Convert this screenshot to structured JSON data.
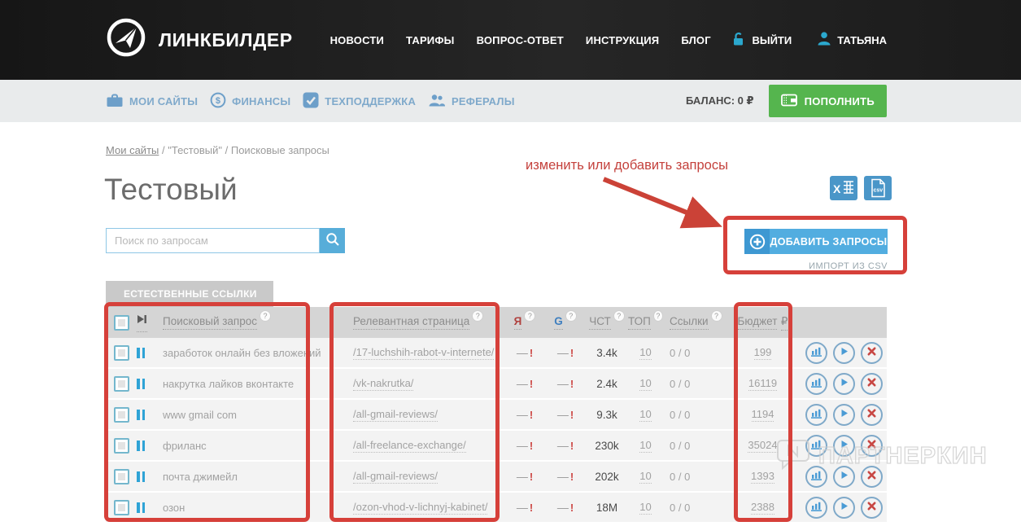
{
  "header": {
    "brand": "ЛИНКБИЛДЕР",
    "nav": [
      "НОВОСТИ",
      "ТАРИФЫ",
      "ВОПРОС-ОТВЕТ",
      "ИНСТРУКЦИЯ",
      "БЛОГ"
    ],
    "logout": "ВЫЙТИ",
    "username": "ТАТЬЯНА"
  },
  "subnav": {
    "items": [
      {
        "label": "МОИ САЙТЫ",
        "icon": "briefcase-icon"
      },
      {
        "label": "ФИНАНСЫ",
        "icon": "dollar-circle-icon"
      },
      {
        "label": "ТЕХПОДДЕРЖКА",
        "icon": "check-square-icon"
      },
      {
        "label": "РЕФЕРАЛЫ",
        "icon": "people-icon"
      }
    ],
    "balance": "БАЛАНС: 0 ₽",
    "topup": "ПОПОЛНИТЬ"
  },
  "breadcrumb": {
    "home": "Мои сайты",
    "sep": "/",
    "site": "\"Тестовый\"",
    "page": "Поисковые запросы"
  },
  "page": {
    "title": "Тестовый"
  },
  "annotation": {
    "text": "изменить или добавить запросы"
  },
  "search": {
    "placeholder": "Поиск по запросам"
  },
  "add": {
    "button": "ДОБАВИТЬ ЗАПРОСЫ",
    "import": "ИМПОРТ ИЗ CSV"
  },
  "export": {
    "excel_icon": "excel-export-icon",
    "csv_icon": "csv-export-icon"
  },
  "tab": {
    "label": "ЕСТЕСТВЕННЫЕ ССЫЛКИ"
  },
  "table": {
    "columns": {
      "query": "Поисковый запрос",
      "page": "Релевантная страница",
      "yandex": "Я",
      "google": "G",
      "chst": "ЧСТ",
      "top": "ТОП",
      "links": "Ссылки",
      "budget": "Бюджет",
      "currency": "₽",
      "help_badge": "?"
    },
    "marks": {
      "dash": "—",
      "alert": "!"
    },
    "rows": [
      {
        "query": "заработок онлайн без вложений",
        "page": "/17-luchshih-rabot-v-internete/",
        "chst": "3.4k",
        "top": "10",
        "links": "0 / 0",
        "budget": "199"
      },
      {
        "query": "накрутка лайков вконтакте",
        "page": "/vk-nakrutka/",
        "chst": "2.4k",
        "top": "10",
        "links": "0 / 0",
        "budget": "16119"
      },
      {
        "query": "www gmail com",
        "page": "/all-gmail-reviews/",
        "chst": "9.3k",
        "top": "10",
        "links": "0 / 0",
        "budget": "1194"
      },
      {
        "query": "фриланс",
        "page": "/all-freelance-exchange/",
        "chst": "230k",
        "top": "10",
        "links": "0 / 0",
        "budget": "35024"
      },
      {
        "query": "почта джимейл",
        "page": "/all-gmail-reviews/",
        "chst": "202k",
        "top": "10",
        "links": "0 / 0",
        "budget": "1393"
      },
      {
        "query": "озон",
        "page": "/ozon-vhod-v-lichnyj-kabinet/",
        "chst": "18M",
        "top": "10",
        "links": "0 / 0",
        "budget": "2388"
      }
    ]
  },
  "watermark": {
    "text": "ПАРТНЕРКИН"
  },
  "colors": {
    "accent_teal": "#2ba8ce",
    "accent_blue": "#52ade0",
    "steel_blue": "#7fa9cb",
    "green": "#55b54e",
    "annotation_red": "#d6403a",
    "alert_red": "#cc4744"
  }
}
